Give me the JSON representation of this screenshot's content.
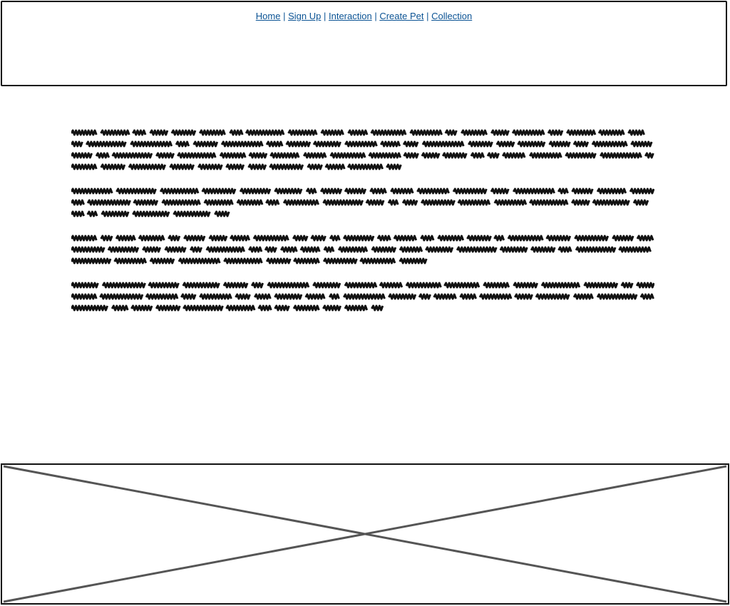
{
  "nav": {
    "links": [
      "Home",
      "Sign Up",
      "Interaction",
      "Create Pet",
      "Collection"
    ],
    "separator": "|"
  },
  "content": {
    "paragraph_lines": [
      4,
      3,
      3,
      3
    ]
  },
  "footer": {
    "image_placeholder": "image-placeholder-x"
  },
  "colors": {
    "link": "#0b5394",
    "border": "#111111",
    "placeholder_x": "#555555",
    "scribble": "#111111"
  }
}
